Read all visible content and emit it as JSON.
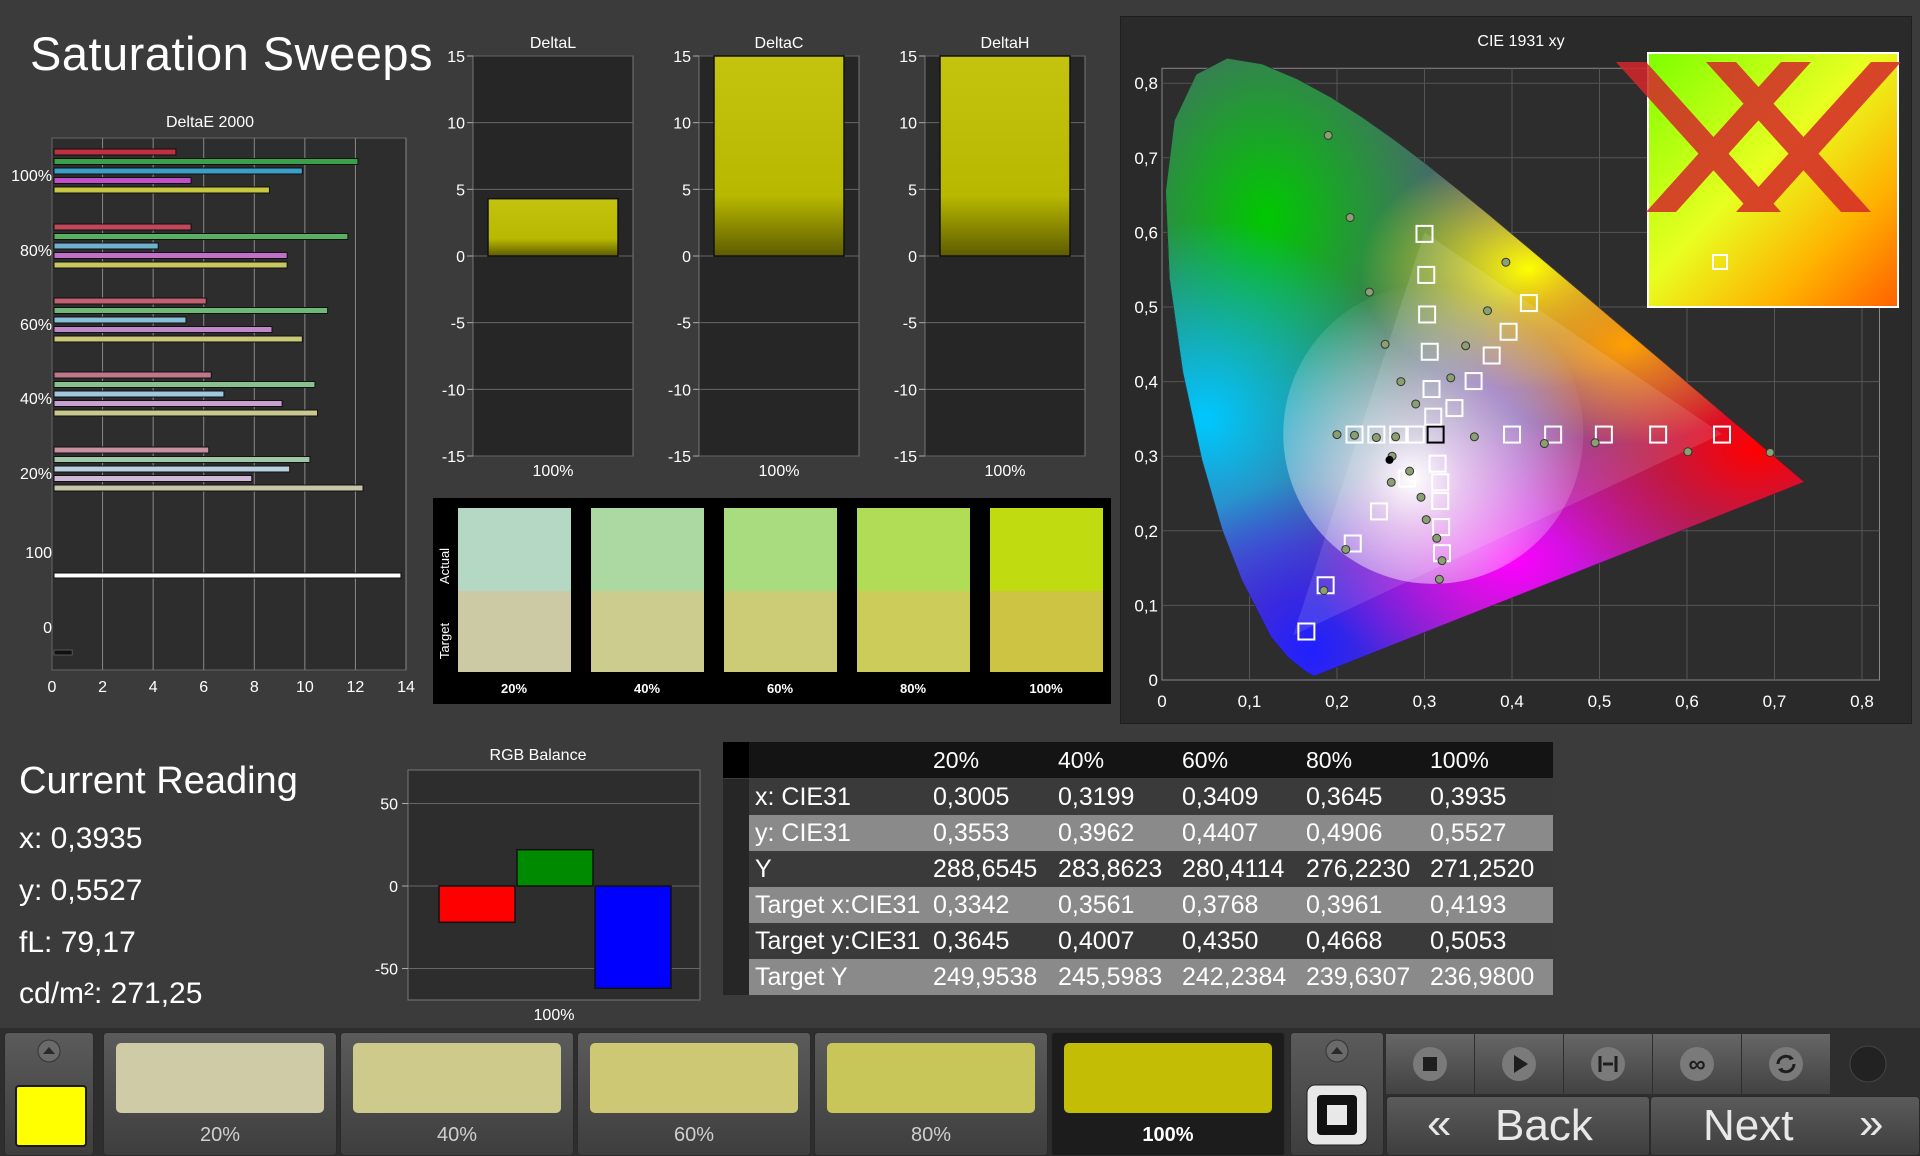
{
  "page_title": "Saturation Sweeps",
  "deltaE": {
    "title": "DeltaE 2000",
    "x_ticks": [
      "0",
      "2",
      "4",
      "6",
      "8",
      "10",
      "12",
      "14"
    ],
    "y_labels": [
      "100%",
      "80%",
      "60%",
      "40%",
      "20%",
      "100",
      "0"
    ],
    "groups": [
      {
        "label": "100%",
        "bars": [
          {
            "v": 4.9,
            "c": "#c03040"
          },
          {
            "v": 12.1,
            "c": "#3aa04a"
          },
          {
            "v": 9.9,
            "c": "#3aa0c8"
          },
          {
            "v": 5.5,
            "c": "#c050c8"
          },
          {
            "v": 8.6,
            "c": "#c8c840"
          }
        ]
      },
      {
        "label": "80%",
        "bars": [
          {
            "v": 5.5,
            "c": "#c04858"
          },
          {
            "v": 11.7,
            "c": "#58b060"
          },
          {
            "v": 4.2,
            "c": "#70b0d0"
          },
          {
            "v": 9.3,
            "c": "#c070c8"
          },
          {
            "v": 9.3,
            "c": "#c8c860"
          }
        ]
      },
      {
        "label": "60%",
        "bars": [
          {
            "v": 6.1,
            "c": "#c06070"
          },
          {
            "v": 10.9,
            "c": "#70b878"
          },
          {
            "v": 5.3,
            "c": "#88c0d8"
          },
          {
            "v": 8.7,
            "c": "#c088c8"
          },
          {
            "v": 9.9,
            "c": "#c8c878"
          }
        ]
      },
      {
        "label": "40%",
        "bars": [
          {
            "v": 6.3,
            "c": "#c07888"
          },
          {
            "v": 10.4,
            "c": "#88c090"
          },
          {
            "v": 6.8,
            "c": "#a0c8e0"
          },
          {
            "v": 9.1,
            "c": "#c8a0d0"
          },
          {
            "v": 10.5,
            "c": "#c8c890"
          }
        ]
      },
      {
        "label": "20%",
        "bars": [
          {
            "v": 6.2,
            "c": "#c890a0"
          },
          {
            "v": 10.2,
            "c": "#a0c8a8"
          },
          {
            "v": 9.4,
            "c": "#b8d0e0"
          },
          {
            "v": 7.9,
            "c": "#d0b8d8"
          },
          {
            "v": 12.3,
            "c": "#c8c8a8"
          }
        ]
      }
    ],
    "white_bar": 13.8,
    "black_bar": 0.8
  },
  "delta_charts": [
    {
      "title": "DeltaL",
      "value": 4.3,
      "label": "100%"
    },
    {
      "title": "DeltaC",
      "value": 15,
      "label": "100%"
    },
    {
      "title": "DeltaH",
      "value": 15,
      "label": "100%"
    }
  ],
  "delta_ticks": [
    "15",
    "10",
    "5",
    "0",
    "-5",
    "-10",
    "-15"
  ],
  "comparison": {
    "actual_label": "Actual",
    "target_label": "Target",
    "items": [
      {
        "label": "20%",
        "actual": "#b4d8c4",
        "target": "#cccaa4"
      },
      {
        "label": "40%",
        "actual": "#acd8a2",
        "target": "#cccc8e"
      },
      {
        "label": "60%",
        "actual": "#a8dc7e",
        "target": "#cccc76"
      },
      {
        "label": "80%",
        "actual": "#b0dc56",
        "target": "#cccc5a"
      },
      {
        "label": "100%",
        "actual": "#c0dc10",
        "target": "#ccc442"
      }
    ]
  },
  "cie": {
    "title": "CIE 1931 xy",
    "x_ticks": [
      "0",
      "0,1",
      "0,2",
      "0,3",
      "0,4",
      "0,5",
      "0,6",
      "0,7",
      "0,8"
    ],
    "y_ticks": [
      "0",
      "0,1",
      "0,2",
      "0,3",
      "0,4",
      "0,5",
      "0,6",
      "0,7",
      "0,8"
    ]
  },
  "current_reading": {
    "title": "Current Reading",
    "x": "x: 0,3935",
    "y": "y: 0,5527",
    "fl": "fL: 79,17",
    "cdm2": "cd/m²: 271,25"
  },
  "rgb_balance": {
    "title": "RGB Balance",
    "ticks": [
      "50",
      "0",
      "-50"
    ],
    "label": "100%",
    "values": [
      {
        "v": -22,
        "c": "#ff0000"
      },
      {
        "v": 22,
        "c": "#008a00"
      },
      {
        "v": -62,
        "c": "#0000ff"
      }
    ]
  },
  "table": {
    "headers": [
      "20%",
      "40%",
      "60%",
      "80%",
      "100%"
    ],
    "rows": [
      {
        "name": "x: CIE31",
        "cells": [
          "0,3005",
          "0,3199",
          "0,3409",
          "0,3645",
          "0,3935"
        ]
      },
      {
        "name": "y: CIE31",
        "cells": [
          "0,3553",
          "0,3962",
          "0,4407",
          "0,4906",
          "0,5527"
        ]
      },
      {
        "name": "Y",
        "cells": [
          "288,6545",
          "283,8623",
          "280,4114",
          "276,2230",
          "271,2520"
        ]
      },
      {
        "name": "Target x:CIE31",
        "cells": [
          "0,3342",
          "0,3561",
          "0,3768",
          "0,3961",
          "0,4193"
        ]
      },
      {
        "name": "Target y:CIE31",
        "cells": [
          "0,3645",
          "0,4007",
          "0,4350",
          "0,4668",
          "0,5053"
        ]
      },
      {
        "name": "Target Y",
        "cells": [
          "249,9538",
          "245,5983",
          "242,2384",
          "239,6307",
          "236,9800"
        ]
      }
    ]
  },
  "bottom": {
    "color_swatch": "#ffff00",
    "steps": [
      {
        "label": "20%",
        "color": "#cfcba6"
      },
      {
        "label": "40%",
        "color": "#cdca8c"
      },
      {
        "label": "60%",
        "color": "#ccc874"
      },
      {
        "label": "80%",
        "color": "#c9c659"
      },
      {
        "label": "100%",
        "color": "#c4bd05"
      }
    ],
    "back": "Back",
    "next": "Next"
  }
}
